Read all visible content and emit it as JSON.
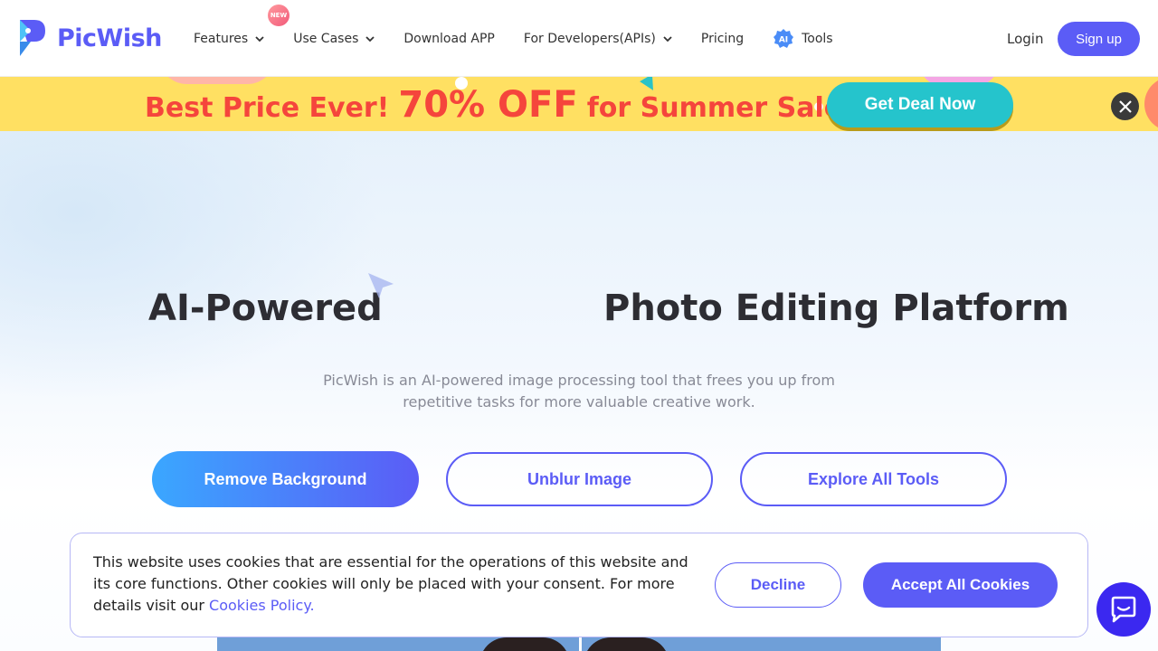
{
  "brand": {
    "name": "PicWish",
    "color": "#5b5cf6"
  },
  "nav": {
    "items": [
      {
        "label": "Features",
        "has_dropdown": true,
        "badge": "NEW"
      },
      {
        "label": "Use Cases",
        "has_dropdown": true
      },
      {
        "label": "Download APP",
        "has_dropdown": false
      },
      {
        "label": "For Developers(APIs)",
        "has_dropdown": true
      },
      {
        "label": "Pricing",
        "has_dropdown": false
      },
      {
        "label": "Tools",
        "has_dropdown": false,
        "icon": "ai-icon",
        "icon_text": "AI"
      }
    ],
    "login": "Login",
    "signup": "Sign up"
  },
  "promo": {
    "text_a": "Best Price Ever!",
    "text_b": "70% OFF",
    "text_c": "for Summer Sale",
    "cta": "Get Deal Now",
    "colors": {
      "background": "#ffe062",
      "text": "#f5453c",
      "cta": "#25c4cc"
    }
  },
  "hero": {
    "title_left": "AI-Powered",
    "title_right": "Photo Editing Platform",
    "subtitle_line1": "PicWish is an AI-powered image processing tool that frees you up from",
    "subtitle_line2": "repetitive tasks for more valuable creative work.",
    "buttons": {
      "primary": "Remove Background",
      "unblur": "Unblur Image",
      "explore": "Explore All Tools"
    }
  },
  "cookie": {
    "text": "This website uses cookies that are essential for the operations of this website and its core functions. Other cookies will only be placed with your consent. For more details visit our ",
    "link": "Cookies Policy.",
    "decline": "Decline",
    "accept": "Accept All Cookies"
  },
  "chat": {
    "icon": "chat-icon"
  }
}
